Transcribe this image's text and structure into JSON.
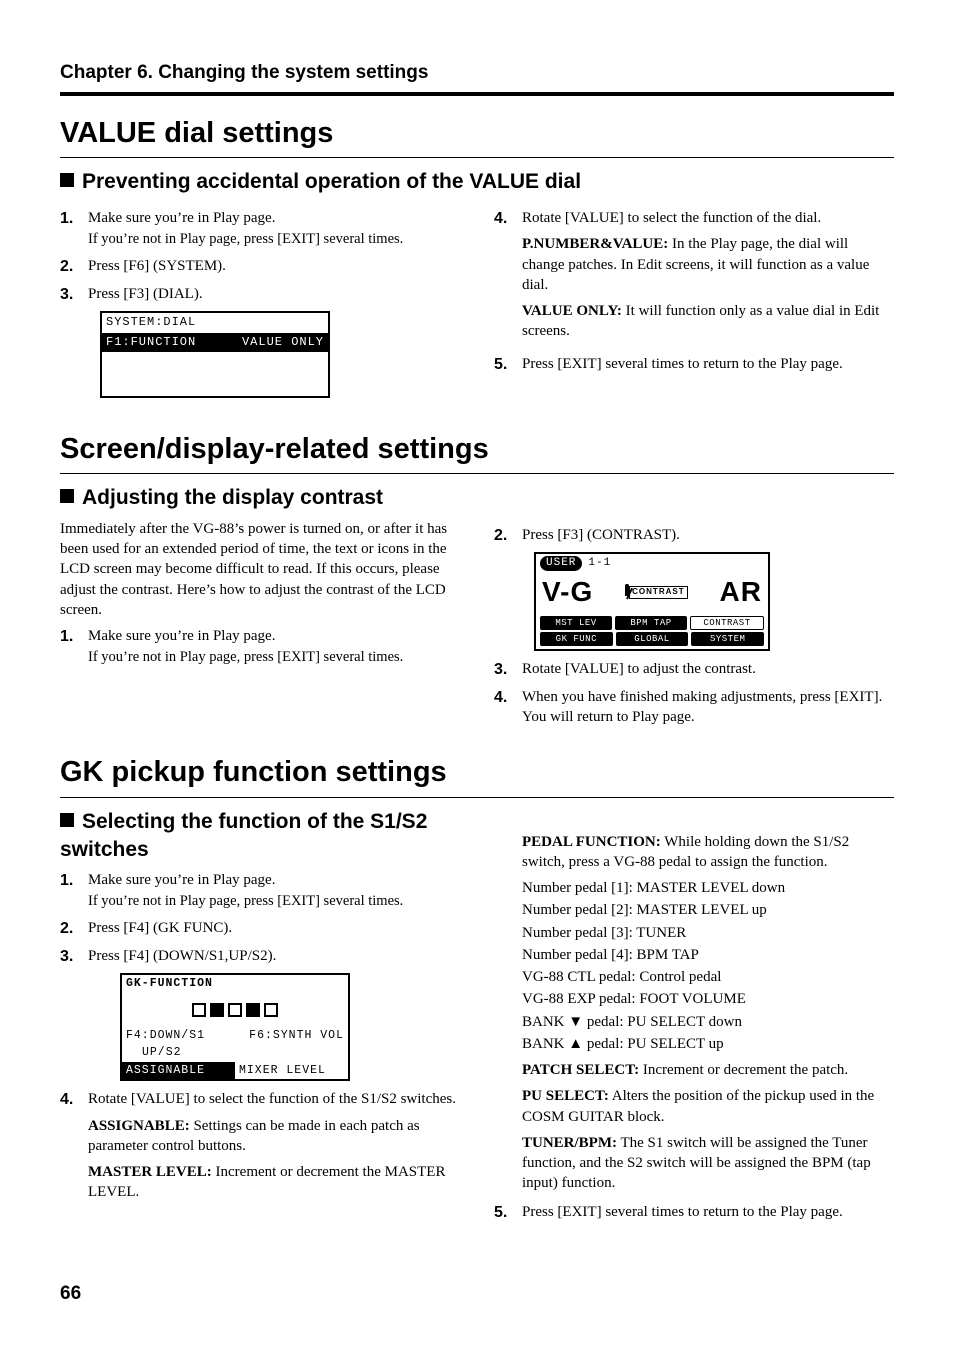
{
  "chapter": "Chapter 6. Changing the system settings",
  "page_number": "66",
  "section1": {
    "title": "VALUE dial settings",
    "subtitle": "Preventing accidental operation of the VALUE dial",
    "left": {
      "s1a": "Make sure you’re in Play page.",
      "s1b": "If you’re not in Play page, press [EXIT] several times.",
      "s2": "Press [F6] (SYSTEM).",
      "s3": "Press [F3] (DIAL).",
      "lcd_title": "SYSTEM:DIAL",
      "lcd_left": "F1:FUNCTION",
      "lcd_right": "VALUE ONLY"
    },
    "right": {
      "s4": "Rotate [VALUE] to select the function of the dial.",
      "p1_label": "P.NUMBER&VALUE:",
      "p1_text": " In the Play page, the dial will change patches. In Edit screens, it will function as a value dial.",
      "p2_label": "VALUE ONLY:",
      "p2_text": " It will function only as a value dial in Edit screens.",
      "s5": "Press [EXIT] several times to return to the Play page."
    }
  },
  "section2": {
    "title": "Screen/display-related settings",
    "subtitle": "Adjusting the display contrast",
    "intro": "Immediately after the VG-88’s power is turned on, or after it has been used for an extended period of time, the text or icons in the LCD screen may become difficult to read. If this occurs, please adjust the contrast. Here’s how to adjust the contrast of the LCD screen.",
    "left": {
      "s1a": "Make sure you’re in Play page.",
      "s1b": "If you’re not in Play page, press [EXIT] several times."
    },
    "right": {
      "s2": "Press [F3] (CONTRAST).",
      "lcd": {
        "pill": "USER",
        "patch": "1-1",
        "big_left": "V-G",
        "big_right": "AR",
        "gauge_label": "CONTRAST",
        "row1": [
          "MST LEV",
          "BPM TAP",
          "CONTRAST"
        ],
        "row2": [
          "GK FUNC",
          "GLOBAL",
          "SYSTEM"
        ]
      },
      "s3": "Rotate [VALUE] to adjust the contrast.",
      "s4": "When you have finished making adjustments, press [EXIT]. You will return to Play page."
    }
  },
  "section3": {
    "title": "GK pickup function settings",
    "subtitle": "Selecting the function of the S1/S2 switches",
    "left": {
      "s1a": "Make sure you’re in Play page.",
      "s1b": "If you’re not in Play page, press [EXIT] several times.",
      "s2": "Press [F4] (GK FUNC).",
      "s3": "Press [F4] (DOWN/S1,UP/S2).",
      "lcd": {
        "title": "GK-FUNCTION",
        "line1_left": "F4:DOWN/S1",
        "line1_right": "F6:SYNTH VOL",
        "line2_left": "UP/S2",
        "line3_left": "ASSIGNABLE",
        "line3_right": "MIXER LEVEL"
      },
      "s4": "Rotate [VALUE] to select the function of the S1/S2 switches.",
      "assignable_label": "ASSIGNABLE:",
      "assignable_text": " Settings can be made in each patch as parameter control buttons.",
      "master_label": "MASTER LEVEL:",
      "master_text": " Increment or decrement the MASTER LEVEL."
    },
    "right": {
      "pf_label": "PEDAL FUNCTION:",
      "pf_text": " While holding down the S1/S2 switch, press a VG-88 pedal to assign the function.",
      "np1": "Number pedal [1]: MASTER LEVEL down",
      "np2": "Number pedal [2]: MASTER LEVEL up",
      "np3": "Number pedal [3]: TUNER",
      "np4": "Number pedal [4]: BPM TAP",
      "ctl": "VG-88 CTL pedal: Control pedal",
      "exp": "VG-88 EXP pedal: FOOT VOLUME",
      "bank_down_pre": "BANK ",
      "bank_down_post": " pedal: PU SELECT down",
      "bank_up_pre": "BANK ",
      "bank_up_post": " pedal: PU SELECT up",
      "patch_label": "PATCH SELECT:",
      "patch_text": " Increment or decrement the patch.",
      "pu_label": "PU SELECT:",
      "pu_text": " Alters the position of the pickup used in the COSM GUITAR block.",
      "tuner_label": "TUNER/BPM:",
      "tuner_text": " The S1 switch will be assigned the Tuner function, and the S2 switch will be assigned the BPM (tap input) function.",
      "s5": "Press [EXIT] several times to return to the Play page."
    }
  }
}
